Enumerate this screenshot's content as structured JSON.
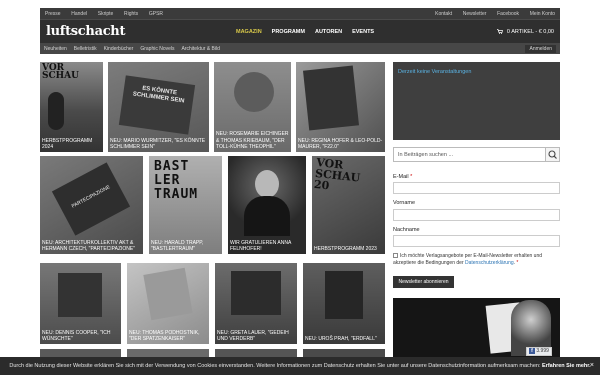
{
  "topbar": {
    "left": [
      "Presse",
      "Handel",
      "Skripte",
      "Rights",
      "GPSR"
    ],
    "right": [
      "Kontakt",
      "Newsletter",
      "Facebook",
      "Mein Konto"
    ]
  },
  "header": {
    "logo": "luftschacht",
    "nav": [
      "MAGAZIN",
      "PROGRAMM",
      "AUTOREN",
      "EVENTS"
    ],
    "active_nav": "MAGAZIN",
    "cart": "0 ARTIKEL - € 0,00"
  },
  "subnav": {
    "items": [
      "Neuheiten",
      "Belletristik",
      "Kinderbücher",
      "Graphic Novels",
      "Architektur & Bild"
    ],
    "login": "Anmelden"
  },
  "posts": [
    {
      "caption": "HERBSTPROGRAMM 2024",
      "cover_text": "VOR SCHAU"
    },
    {
      "caption": "NEU: MARIO WURMITZER, \"ES KÖNNTE SCHLIMMER SEIN\"",
      "cover_text": "ES KÖNNTE SCHLIMMER SEIN"
    },
    {
      "caption": "NEU: ROSEMARIE EICHINGER & THOMAS KRIEBAUM, \"DER TOLL-KÜHNE THEOPHIL\"",
      "cover_text": ""
    },
    {
      "caption": "NEU: REGINA HOFER & LEO-POLD-MAURER, \"F22.0\"",
      "cover_text": ""
    },
    {
      "caption": "NEU: ARCHITEKTURKOLLEKTIV AKT & HERMANN CZECH, \"PARTECIPAZIONE\"",
      "cover_text": "PARTECIPAZIONE"
    },
    {
      "caption": "NEU: HARALD TRAPP, \"BASTLERTRAUM\"",
      "cover_text": "BAST LER TRAUM"
    },
    {
      "caption": "WIR GRATULIEREN ANNA FELNHOFER!",
      "cover_text": ""
    },
    {
      "caption": "HERBSTPROGRAMM 2023",
      "cover_text": "VOR SCHAU 20"
    },
    {
      "caption": "NEU: DENNIS COOPER, \"ICH WÜNSCHTE\"",
      "cover_text": ""
    },
    {
      "caption": "NEU: THOMAS PODHOSTNIK, \"DER SPATZENKAISER\"",
      "cover_text": ""
    },
    {
      "caption": "NEU: GRETA LAUER, \"GEDEIH UND VERDERB\"",
      "cover_text": ""
    },
    {
      "caption": "NEU: UROŠ PRAH, \"ERDFALL\"",
      "cover_text": ""
    }
  ],
  "sidebar": {
    "events_text": "Derzeit keine Veranstaltungen",
    "search_placeholder": "In Beiträgen suchen ...",
    "email_label": "E-Mail",
    "vorname_label": "Vorname",
    "nachname_label": "Nachname",
    "consent_text": "Ich möchte Verlagsangebote per E-Mail-Newsletter erhalten und akzeptiere die Bedingungen der",
    "consent_link": "Datenschutzerklärung",
    "subscribe": "Newsletter abonnieren",
    "fb_count": "3.999"
  },
  "cookie": {
    "text": "Durch die Nutzung dieser Website erklären Sie sich mit der Verwendung von Cookies einverstanden. Weitere Informationen zum Datenschutz erhalten Sie unter auf unsere Datenschutzinformation aufmerksam machen:",
    "link": "Erfahren Sie mehr."
  }
}
